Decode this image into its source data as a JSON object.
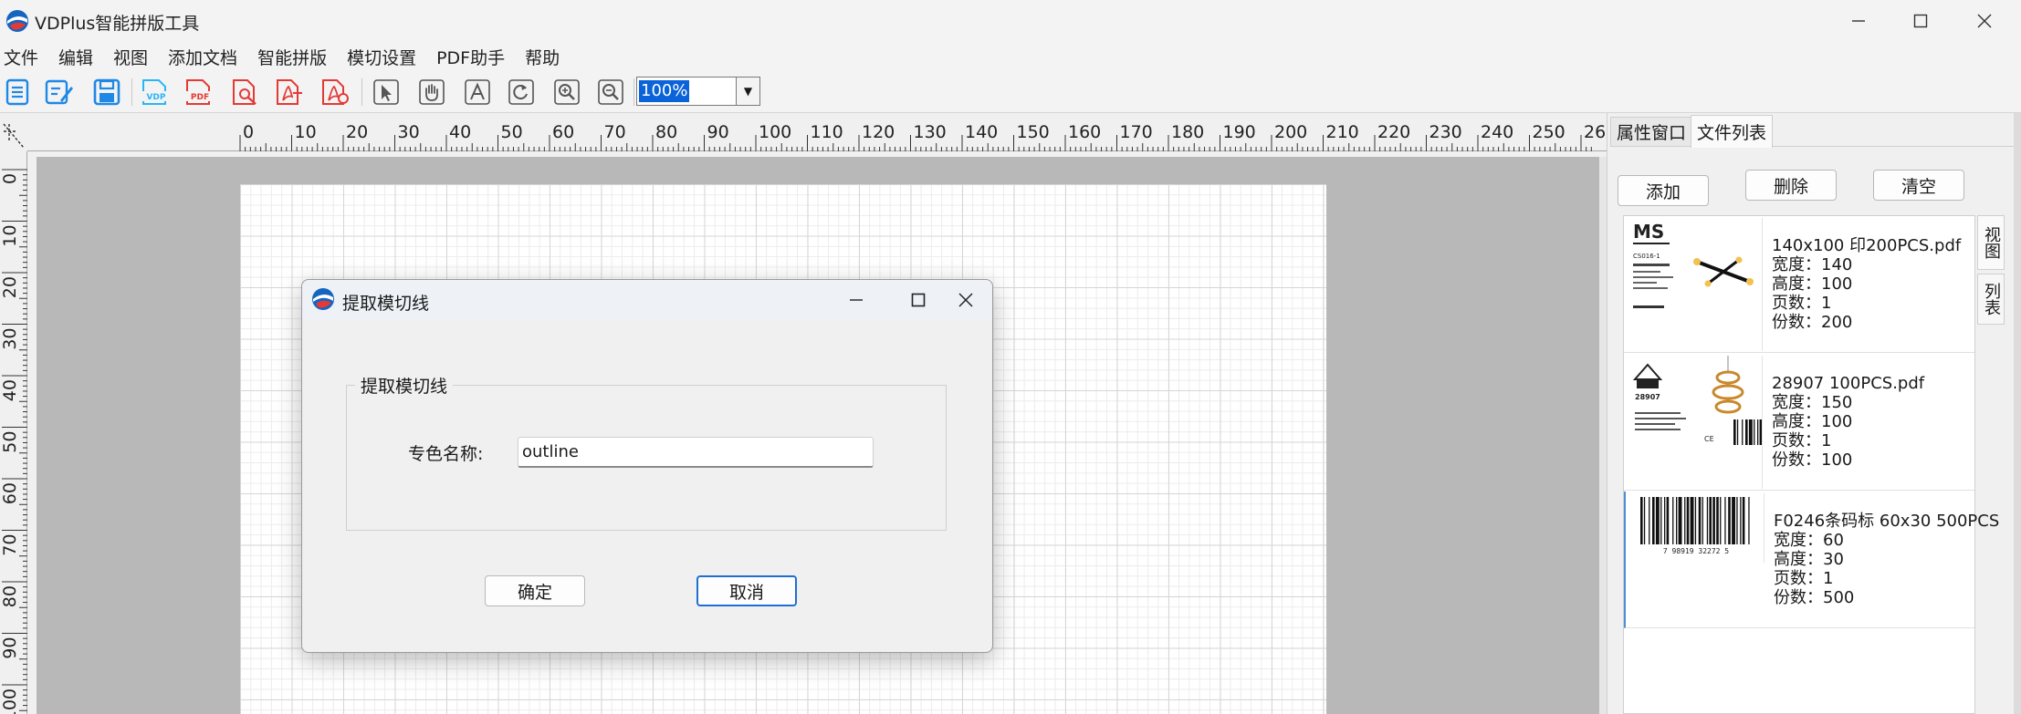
{
  "window": {
    "title": "VDPlus智能拼版工具",
    "minimize": "—",
    "maximize": "☐",
    "close": "✕"
  },
  "menu": [
    "文件",
    "编辑",
    "视图",
    "添加文档",
    "智能拼版",
    "模切设置",
    "PDF助手",
    "帮助"
  ],
  "toolbar": {
    "zoom": "100%",
    "zoom_dropdown": "▼",
    "vdp_label": "VDP",
    "pdf_label": "PDF"
  },
  "ruler_top": [
    "0",
    "10",
    "20",
    "30",
    "40",
    "50",
    "60",
    "70",
    "80",
    "90",
    "100",
    "110",
    "120",
    "130",
    "140",
    "150",
    "160",
    "170",
    "180",
    "190",
    "200",
    "210",
    "220",
    "230",
    "240",
    "250",
    "26"
  ],
  "ruler_left": [
    "0",
    "10",
    "20",
    "30",
    "40",
    "50",
    "60",
    "70",
    "80",
    "90",
    "100"
  ],
  "dialog": {
    "title": "提取模切线",
    "group_title": "提取模切线",
    "spot_color_label": "专色名称:",
    "spot_color_value": "outline",
    "ok": "确定",
    "cancel": "取消",
    "minimize": "—",
    "maximize": "☐",
    "close": "✕"
  },
  "panel": {
    "tabs": [
      "属性窗口",
      "文件列表"
    ],
    "buttons": {
      "add": "添加",
      "delete": "删除",
      "clear": "清空"
    },
    "side_tabs": [
      "视图",
      "列表"
    ],
    "files": [
      {
        "name": "140x100 印200PCS.pdf",
        "width": "宽度：140",
        "height": "高度：100",
        "pages": "页数：1",
        "copies": "份数：200",
        "thumb_text": [
          "MS",
          "CS016-1"
        ]
      },
      {
        "name": "28907 100PCS.pdf",
        "width": "宽度：150",
        "height": "高度：100",
        "pages": "页数：1",
        "copies": "份数：100",
        "thumb_text": [
          "28907",
          "CE"
        ]
      },
      {
        "name": "F0246条码标 60x30 500PCS",
        "width": "宽度：60",
        "height": "高度：30",
        "pages": "页数：1",
        "copies": "份数：500",
        "thumb_text": [
          "7 98919 32272 5"
        ]
      }
    ]
  }
}
